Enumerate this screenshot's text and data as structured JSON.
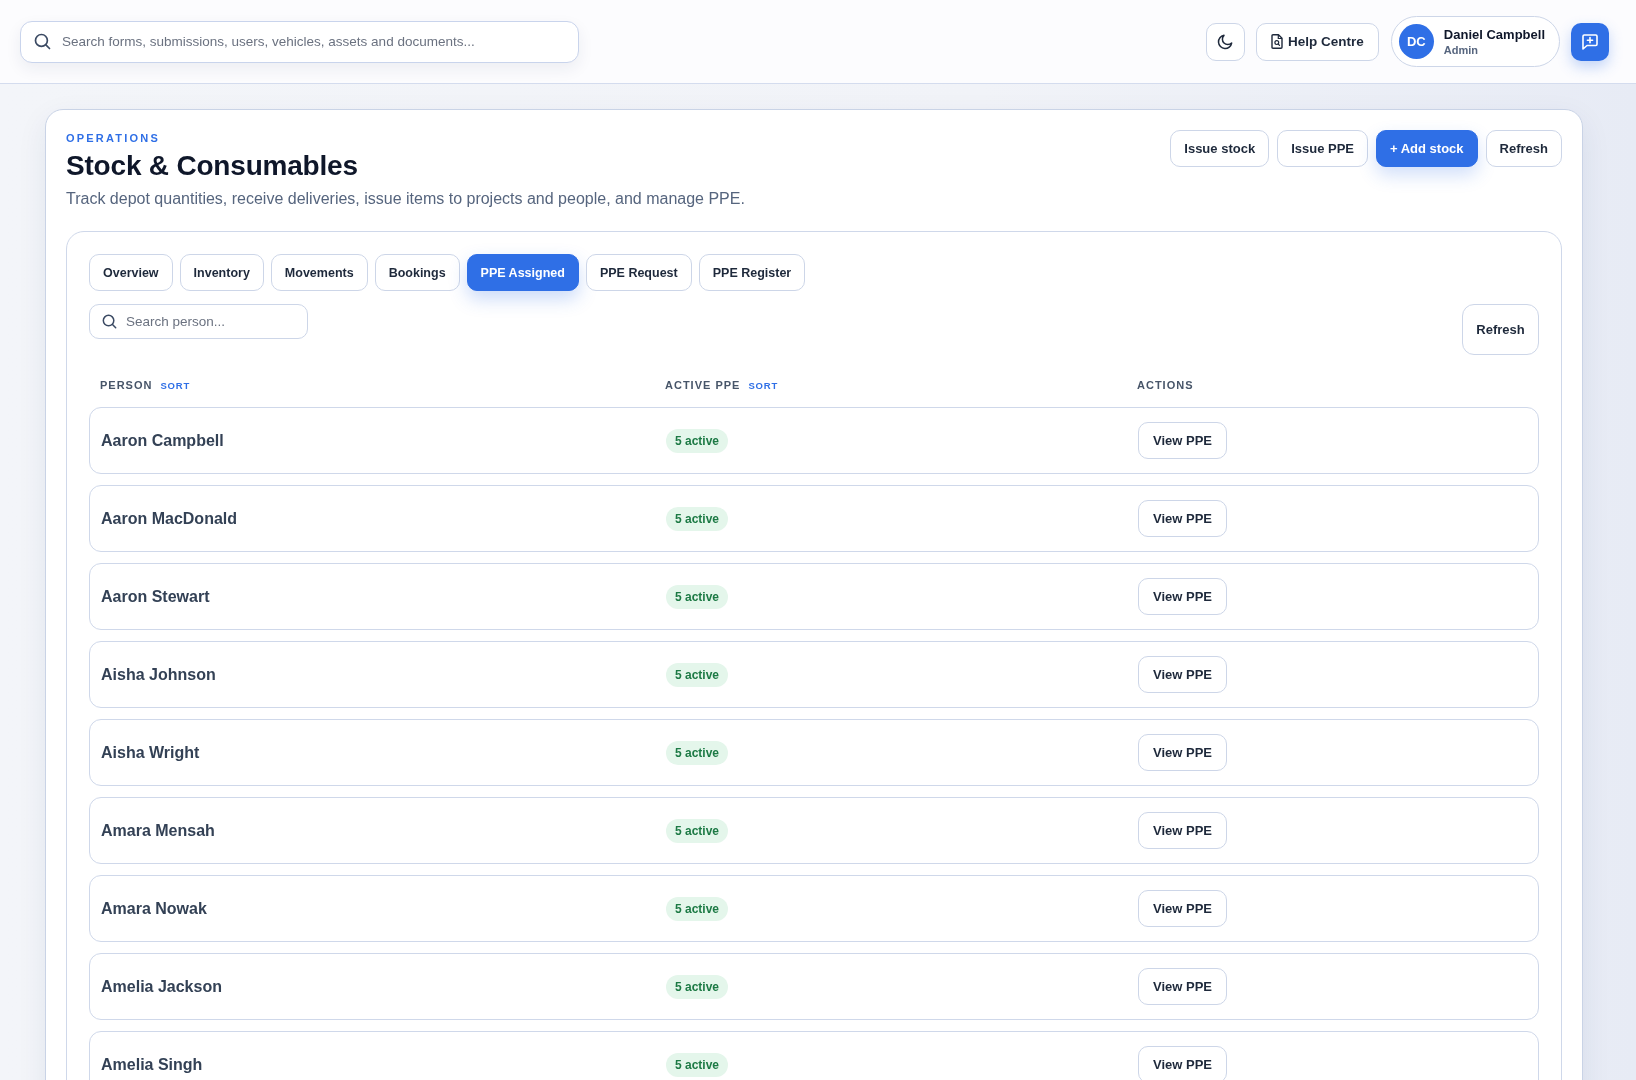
{
  "top_bar": {
    "search": {
      "placeholder": "Search forms, submissions, users, vehicles, assets and documents..."
    },
    "help_button": "Help Centre",
    "user": {
      "initials": "DC",
      "name": "Daniel Campbell",
      "role": "Admin"
    }
  },
  "page": {
    "eyebrow": "OPERATIONS",
    "title": "Stock & Consumables",
    "subtitle": "Track depot quantities, receive deliveries, issue items to projects and people, and manage PPE.",
    "actions": [
      {
        "label": "Issue stock",
        "primary": false
      },
      {
        "label": "Issue PPE",
        "primary": false
      },
      {
        "label": "+ Add stock",
        "primary": true
      },
      {
        "label": "Refresh",
        "primary": false
      }
    ]
  },
  "tabs": [
    {
      "label": "Overview",
      "selected": false
    },
    {
      "label": "Inventory",
      "selected": false
    },
    {
      "label": "Movements",
      "selected": false
    },
    {
      "label": "Bookings",
      "selected": false
    },
    {
      "label": "PPE Assigned",
      "selected": true
    },
    {
      "label": "PPE Request",
      "selected": false
    },
    {
      "label": "PPE Register",
      "selected": false
    }
  ],
  "person_search": {
    "placeholder": "Search person..."
  },
  "refresh_button": "Refresh",
  "table": {
    "columns": [
      {
        "label": "PERSON",
        "sort": "SORT"
      },
      {
        "label": "ACTIVE PPE",
        "sort": "SORT"
      },
      {
        "label": "ACTIONS"
      }
    ],
    "rows": [
      {
        "person": "Aaron Campbell",
        "active_ppe": "5 active",
        "action": "View PPE"
      },
      {
        "person": "Aaron MacDonald",
        "active_ppe": "5 active",
        "action": "View PPE"
      },
      {
        "person": "Aaron Stewart",
        "active_ppe": "5 active",
        "action": "View PPE"
      },
      {
        "person": "Aisha Johnson",
        "active_ppe": "5 active",
        "action": "View PPE"
      },
      {
        "person": "Aisha Wright",
        "active_ppe": "5 active",
        "action": "View PPE"
      },
      {
        "person": "Amara Mensah",
        "active_ppe": "5 active",
        "action": "View PPE"
      },
      {
        "person": "Amara Nowak",
        "active_ppe": "5 active",
        "action": "View PPE"
      },
      {
        "person": "Amelia Jackson",
        "active_ppe": "5 active",
        "action": "View PPE"
      },
      {
        "person": "Amelia Singh",
        "active_ppe": "5 active",
        "action": "View PPE"
      }
    ]
  }
}
